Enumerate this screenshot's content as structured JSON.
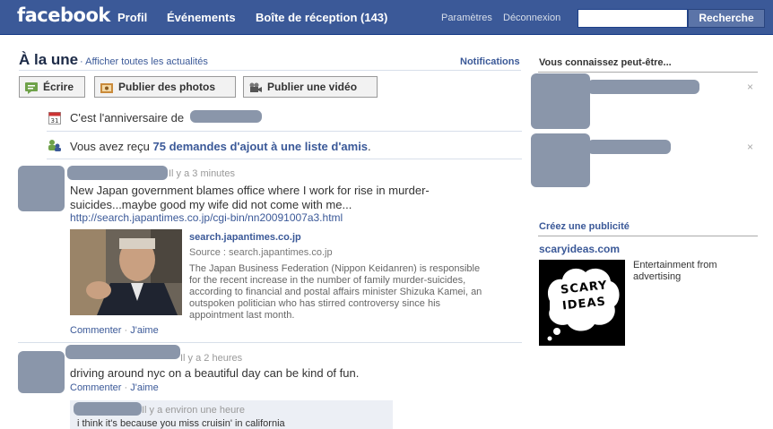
{
  "topbar": {
    "logo": "facebook",
    "nav": [
      "Profil",
      "Événements",
      "Boîte de réception (143)"
    ],
    "settings": "Paramètres",
    "logout": "Déconnexion",
    "search_value": "",
    "search_button": "Recherche"
  },
  "feed": {
    "title": "À la une",
    "subtitle": "· Afficher toutes les actualités",
    "notifications": "Notifications",
    "actions": {
      "write": "Écrire",
      "photos": "Publier des photos",
      "video": "Publier une vidéo"
    },
    "birthday": "C'est l'anniversaire de",
    "requests_prefix": "Vous avez reçu ",
    "requests_link": "75 demandes d'ajout à une liste d'amis",
    "requests_suffix": "."
  },
  "post1": {
    "time": "Il y a 3 minutes",
    "text": "New Japan government blames office where I work for rise in murder-suicides...maybe good my wife did not come with me...",
    "url": "http://search.japantimes.co.jp/cgi-bin/nn20091007a3.html",
    "link_title": "search.japantimes.co.jp",
    "link_source": "Source : search.japantimes.co.jp",
    "link_desc": "The Japan Business Federation (Nippon Keidanren) is responsible for the recent increase in the number of family murder-suicides, according to financial and postal affairs minister Shizuka Kamei, an outspoken politician who has stirred controversy since his appointment last month.",
    "comment": "Commenter",
    "like": "J'aime"
  },
  "post2": {
    "time": "Il y a 2 heures",
    "text": "driving around nyc on a beautiful day can be kind of fun.",
    "comment": "Commenter",
    "like": "J'aime",
    "reply_time": "Il y a environ une heure",
    "reply_text": "i think it's because you miss cruisin' in california"
  },
  "sidebar": {
    "pymk_title": "Vous connaissez peut-être...",
    "close": "×",
    "ad_title": "Créez une publicité",
    "ad_site": "scaryideas.com",
    "ad_text": "Entertainment from advertising",
    "ad_logo": [
      "SCARY",
      "IDEAS"
    ]
  },
  "colors": {
    "topbar": "#3b5998",
    "link": "#3b5998",
    "redacted": "#8a96aa"
  }
}
